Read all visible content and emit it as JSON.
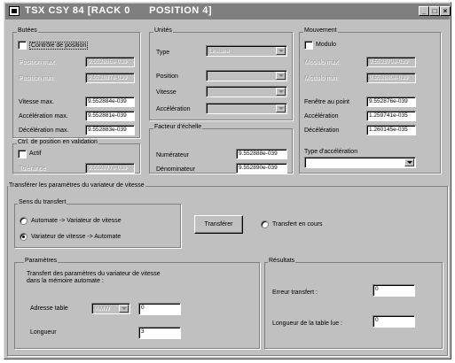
{
  "window": {
    "title": "TSX CSY 84 [RACK 0      POSITION 4]",
    "minimize_glyph": "_",
    "maximize_glyph": "□",
    "close_glyph": "×"
  },
  "butees": {
    "title": "Butées",
    "controle_position": "Contrôle de position",
    "position_max_label": "Position max.",
    "position_max_value": "9.552886e-039",
    "position_min_label": "Position min.",
    "position_min_value": "9.552887e-039",
    "vitesse_max_label": "Vitesse max.",
    "vitesse_max_value": "9.552884e-039",
    "acceleration_max_label": "Accélération max.",
    "acceleration_max_value": "9.552881e-039",
    "deceleration_max_label": "Décélération max.",
    "deceleration_max_value": "9.552883e-039"
  },
  "ctrl_position": {
    "title": "Ctrl. de position en validation",
    "actif": "Actif",
    "tolerance_label": "Tolérance",
    "tolerance_value": "9.552877e-039"
  },
  "unites": {
    "title": "Unités",
    "type_label": "Type",
    "type_value": "Linéaire",
    "position_label": "Position",
    "vitesse_label": "Vitesse",
    "acceleration_label": "Accélération"
  },
  "facteur": {
    "title": "Facteur d'échelle",
    "numerateur_label": "Numérateur",
    "numerateur_value": "9.552888e-039",
    "denominateur_label": "Dénominateur",
    "denominateur_value": "9.552890e-039"
  },
  "mouvement": {
    "title": "Mouvement",
    "modulo": "Modulo",
    "modulo_max_label": "Modulo max.",
    "modulo_max_value": "9.552879e-039",
    "modulo_min_label": "Modulo min.",
    "modulo_min_value": "9.552880e-039",
    "fenetre_label": "Fenêtre au point",
    "fenetre_value": "9.552876e-039",
    "acceleration_label": "Accélération",
    "acceleration_value": "1.259741e-035",
    "deceleration_label": "Décélération",
    "deceleration_value": "1.260145e-035",
    "type_acc_label": "Type d'accélération",
    "type_acc_value": ""
  },
  "transfer": {
    "title": "Transférer les paramètres du variateur de vitesse",
    "sens_title": "Sens du transfert",
    "option1": "Automate -> Variateur de vitesse",
    "option2": "Variateur de vitesse -> Automate",
    "button": "Transférer",
    "en_cours": "Transfert en cours"
  },
  "parametres": {
    "title": "Paramètres",
    "desc_line1": "Transfert des paramètres du variateur de vitesse",
    "desc_line2": "dans la mémoire automate :",
    "adresse_label": "Adresse table",
    "adresse_type": "%MW",
    "adresse_value": "0",
    "longueur_label": "Longueur",
    "longueur_value": "3"
  },
  "resultats": {
    "title": "Résultats",
    "erreur_label": "Erreur transfert :",
    "erreur_value": "0",
    "longueur_table_label": "Longueur de la table lue :",
    "longueur_table_value": "0"
  }
}
